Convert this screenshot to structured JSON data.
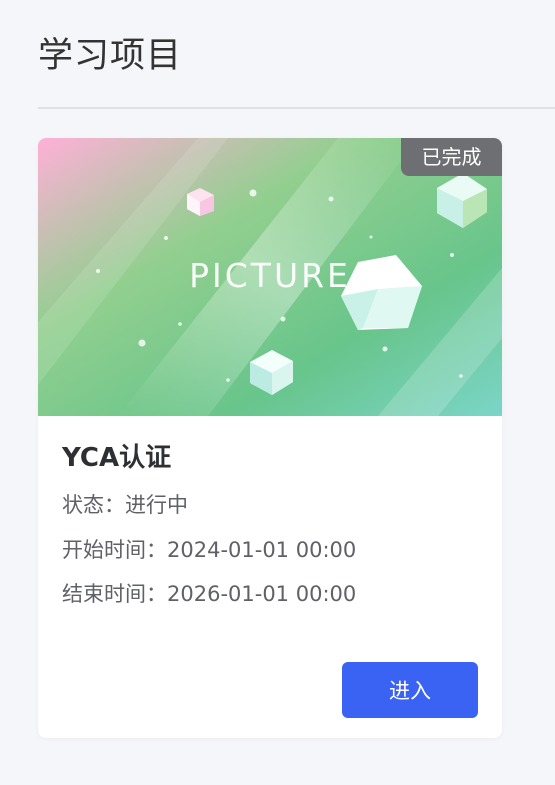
{
  "page": {
    "title": "学习项目"
  },
  "project_card": {
    "badge": "已完成",
    "cover_text": "PICTURE",
    "title": "YCA认证",
    "status_label": "状态：",
    "status_value": "进行中",
    "start_label": "开始时间：",
    "start_value": "2024-01-01 00:00",
    "end_label": "结束时间：",
    "end_value": "2026-01-01 00:00",
    "enter_label": "进入"
  },
  "colors": {
    "page_background": "#f5f6fa",
    "primary_button": "#3a63f3",
    "badge_background": "#6e6f73",
    "cover_pink": "#ffb3d9",
    "cover_green": "#6cc58a",
    "cover_teal": "#6fd1be"
  }
}
